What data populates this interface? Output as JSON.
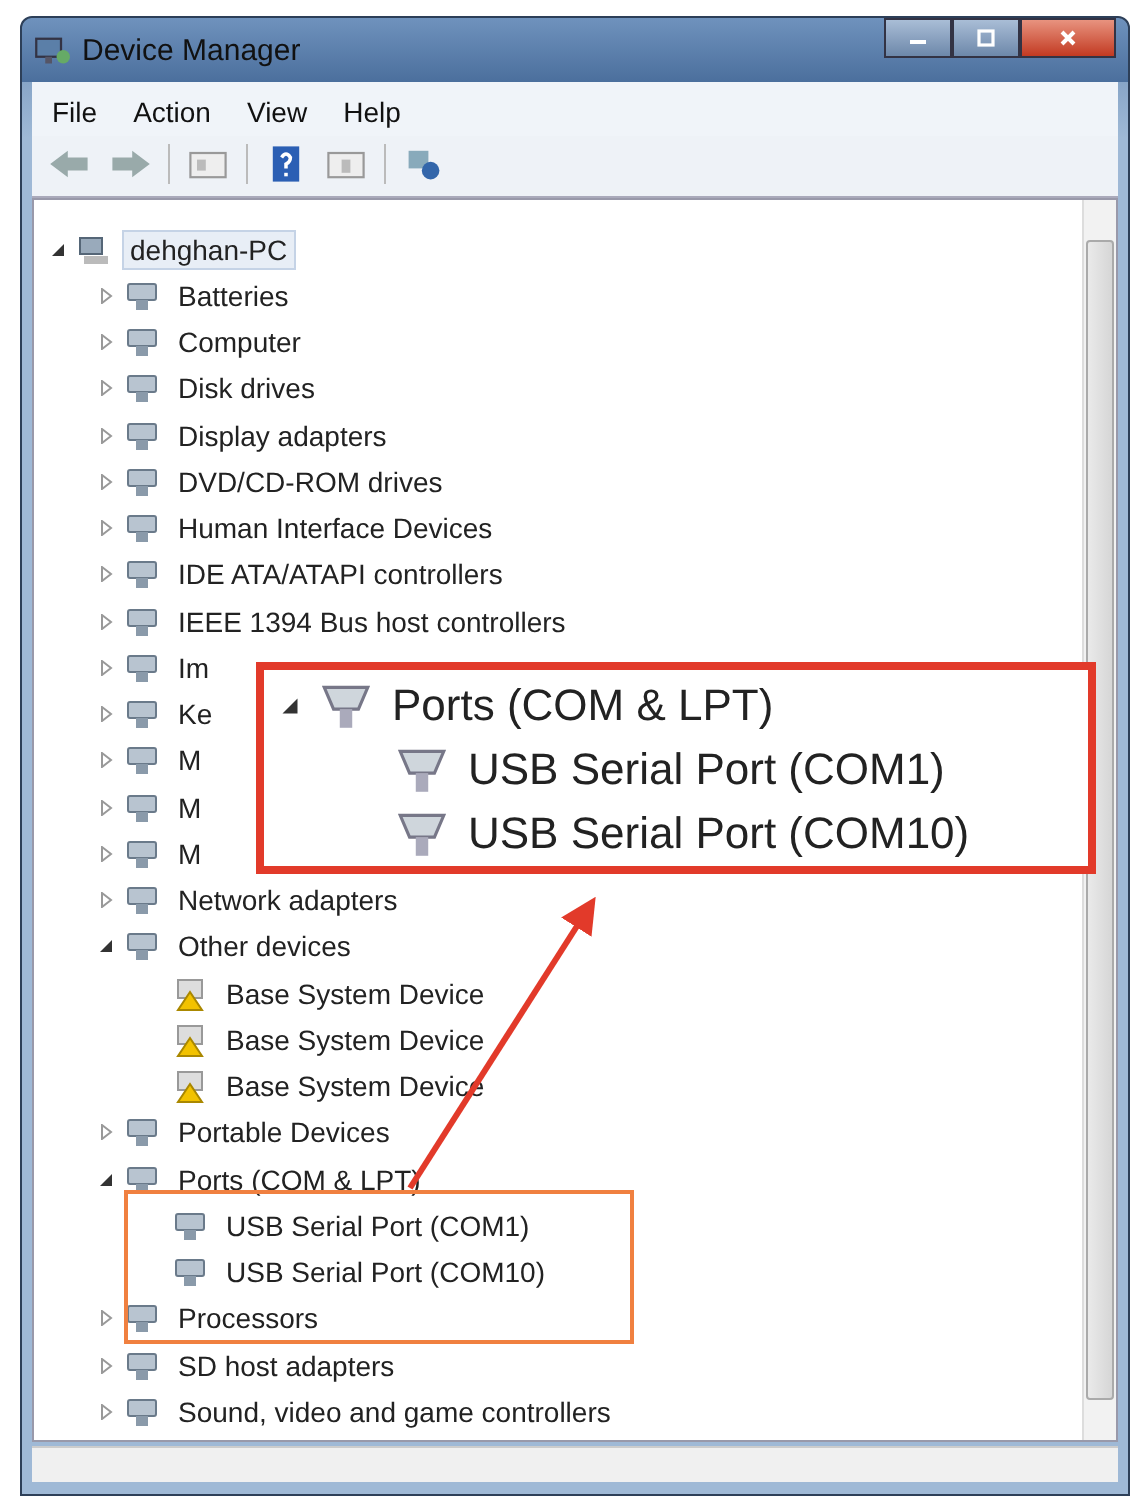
{
  "window": {
    "title": "Device Manager"
  },
  "menu": [
    "File",
    "Action",
    "View",
    "Help"
  ],
  "tree": {
    "label": "dehghan-PC",
    "expanded": true,
    "selected": true,
    "children": [
      {
        "label": "Batteries",
        "expanded": false
      },
      {
        "label": "Computer",
        "expanded": false
      },
      {
        "label": "Disk drives",
        "expanded": false
      },
      {
        "label": "Display adapters",
        "expanded": false
      },
      {
        "label": "DVD/CD-ROM drives",
        "expanded": false
      },
      {
        "label": "Human Interface Devices",
        "expanded": false
      },
      {
        "label": "IDE ATA/ATAPI controllers",
        "expanded": false
      },
      {
        "label": "IEEE 1394 Bus host controllers",
        "expanded": false
      },
      {
        "label": "Im",
        "expanded": false
      },
      {
        "label": "Ke",
        "expanded": false
      },
      {
        "label": "M",
        "expanded": false
      },
      {
        "label": "M",
        "expanded": false
      },
      {
        "label": "M",
        "expanded": false
      },
      {
        "label": "Network adapters",
        "expanded": false
      },
      {
        "label": "Other devices",
        "expanded": true,
        "children": [
          {
            "label": "Base System Device",
            "warning": true
          },
          {
            "label": "Base System Device",
            "warning": true
          },
          {
            "label": "Base System Device",
            "warning": true
          }
        ]
      },
      {
        "label": "Portable Devices",
        "expanded": false
      },
      {
        "label": "Ports (COM & LPT)",
        "expanded": true,
        "children": [
          {
            "label": "USB Serial Port (COM1)",
            "warning": false
          },
          {
            "label": "USB Serial Port (COM10)",
            "warning": false
          }
        ]
      },
      {
        "label": "Processors",
        "expanded": false
      },
      {
        "label": "SD host adapters",
        "expanded": false
      },
      {
        "label": "Sound, video and game controllers",
        "expanded": false
      }
    ]
  },
  "callout": {
    "label": "Ports (COM & LPT)",
    "expanded": true,
    "children": [
      "USB Serial Port (COM1)",
      "USB Serial Port (COM10)"
    ]
  }
}
